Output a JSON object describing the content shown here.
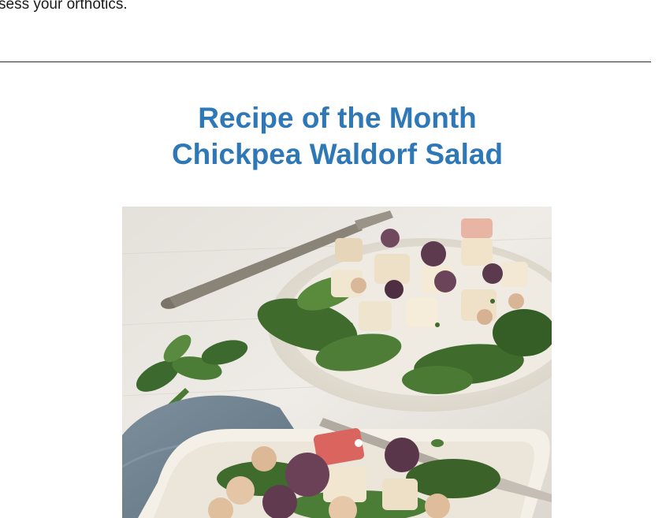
{
  "newsletter": {
    "intro_text": "sess your orthotics.",
    "recipe_heading": "Recipe of the Month",
    "recipe_title": "Chickpea Waldorf Salad"
  },
  "colors": {
    "heading": "#2e78b7",
    "divider": "#2b2b2b",
    "text": "#1a1a1a"
  }
}
